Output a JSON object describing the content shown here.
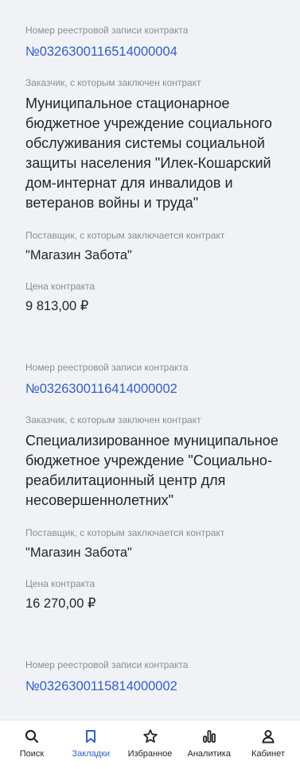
{
  "contracts": [
    {
      "registry_label": "Номер реестровой записи контракта",
      "registry_number": "№0326300116514000004",
      "customer_label": "Заказчик, с которым заключен контракт",
      "customer": "Муниципальное стационарное бюджетное учреждение социального обслуживания системы социальной защиты населения \"Илек-Кошарский дом-интернат для инвалидов и ветеранов войны и труда\"",
      "supplier_label": "Поставщик, с которым заключается  контракт",
      "supplier": "\"Магазин Забота\"",
      "price_label": "Цена контракта",
      "price": "9 813,00 ₽"
    },
    {
      "registry_label": "Номер реестровой записи контракта",
      "registry_number": "№0326300116414000002",
      "customer_label": "Заказчик, с которым заключен контракт",
      "customer": "Специализированное муниципальное бюджетное учреждение \"Социально-реабилитационный центр для несовершеннолетних\"",
      "supplier_label": "Поставщик, с которым заключается  контракт",
      "supplier": "\"Магазин Забота\"",
      "price_label": "Цена контракта",
      "price": "16 270,00 ₽"
    },
    {
      "registry_label": "Номер реестровой записи контракта",
      "registry_number": "№0326300115814000002"
    }
  ],
  "tabbar": {
    "items": [
      {
        "label": "Поиск",
        "icon": "search-icon"
      },
      {
        "label": "Закладки",
        "icon": "bookmark-icon",
        "active": true
      },
      {
        "label": "Избранное",
        "icon": "star-icon"
      },
      {
        "label": "Аналитика",
        "icon": "chart-icon"
      },
      {
        "label": "Кабинет",
        "icon": "user-icon"
      }
    ],
    "active_color": "#2f5fd0",
    "inactive_color": "#23252b"
  }
}
